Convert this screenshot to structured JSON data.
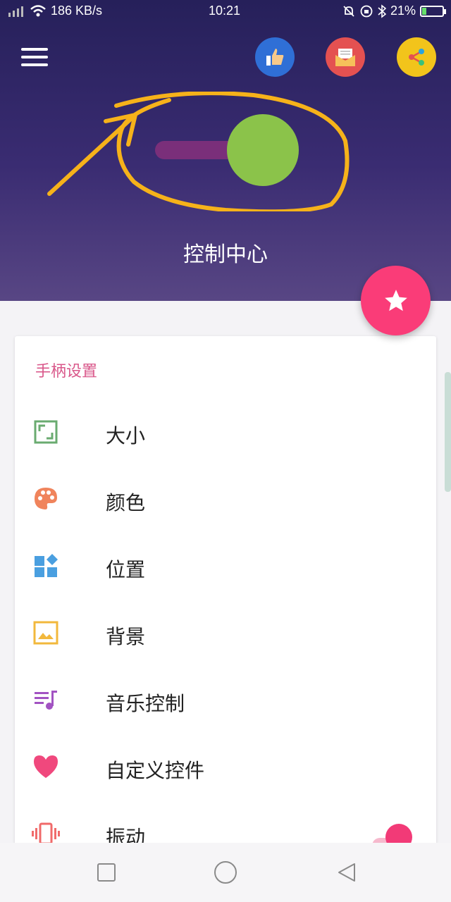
{
  "status_bar": {
    "network_speed": "186 KB/s",
    "time": "10:21",
    "battery_percent": "21%",
    "battery_level": 0.21,
    "icons": [
      "signal-icon",
      "wifi-icon",
      "mute-icon",
      "alarm-icon",
      "bluetooth-icon",
      "battery-icon"
    ]
  },
  "header": {
    "title": "控制中心",
    "actions": [
      "like-icon",
      "mail-icon",
      "share-icon"
    ],
    "colors": {
      "like": "#2f6fd6",
      "mail": "#e45151",
      "share": "#f2c41b"
    }
  },
  "fab": {
    "icon": "star-icon",
    "color": "#fa3c78"
  },
  "settings": {
    "section_title": "手柄设置",
    "items": [
      {
        "label": "大小",
        "icon": "resize-icon",
        "color": "#6aab70"
      },
      {
        "label": "颜色",
        "icon": "palette-icon",
        "color": "#f0845c"
      },
      {
        "label": "位置",
        "icon": "dashboard-icon",
        "color": "#4a9fe0"
      },
      {
        "label": "背景",
        "icon": "image-icon",
        "color": "#f2b83c"
      },
      {
        "label": "音乐控制",
        "icon": "playlist-music-icon",
        "color": "#a253c2"
      },
      {
        "label": "自定义控件",
        "icon": "heart-icon",
        "color": "#f0487d"
      },
      {
        "label": "振动",
        "icon": "vibration-icon",
        "color": "#f06a6a"
      }
    ],
    "vibration_enabled": true
  },
  "nav_bar": [
    "recents-icon",
    "home-icon",
    "back-icon"
  ]
}
